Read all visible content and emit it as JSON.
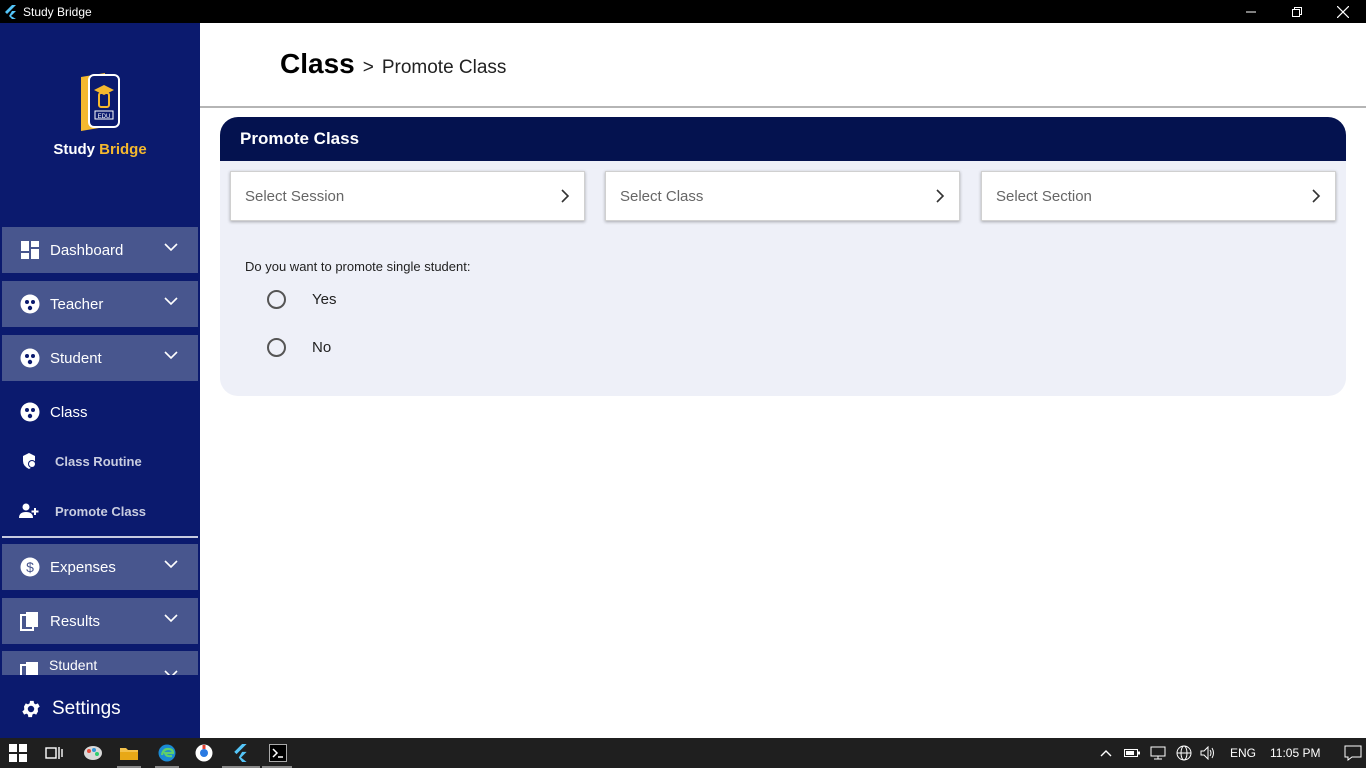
{
  "window": {
    "title": "Study Bridge"
  },
  "logo": {
    "text_part1": "Study ",
    "text_part2": "Bridge",
    "badge": "EDU"
  },
  "sidebar": {
    "items": [
      {
        "label": "Dashboard"
      },
      {
        "label": "Teacher"
      },
      {
        "label": "Student"
      },
      {
        "label": "Class"
      },
      {
        "label": "Class Routine"
      },
      {
        "label": "Promote Class"
      },
      {
        "label": "Expenses"
      },
      {
        "label": "Results"
      },
      {
        "label": "Student"
      }
    ],
    "settings_label": "Settings"
  },
  "header": {
    "main": "Class",
    "separator": ">",
    "sub": "Promote Class"
  },
  "card": {
    "title": "Promote Class",
    "selects": [
      {
        "placeholder": "Select Session"
      },
      {
        "placeholder": "Select Class"
      },
      {
        "placeholder": "Select Section"
      }
    ],
    "question": "Do you want to promote single student:",
    "options": [
      {
        "label": "Yes"
      },
      {
        "label": "No"
      }
    ]
  },
  "taskbar": {
    "language": "ENG",
    "time": "11:05 PM"
  }
}
